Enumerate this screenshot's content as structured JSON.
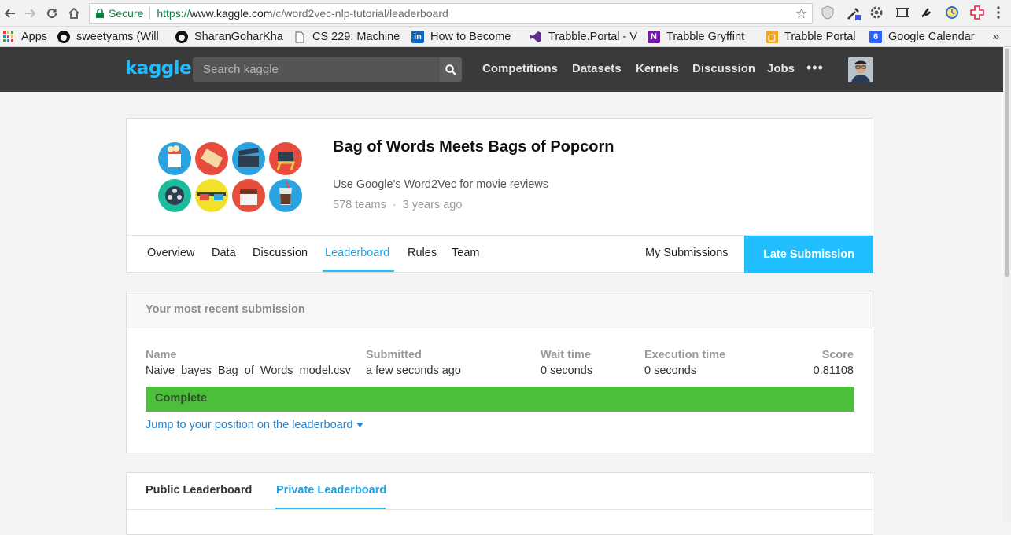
{
  "browser": {
    "secure_label": "Secure",
    "url_scheme": "https://",
    "url_host": "www.kaggle.com",
    "url_path": "/c/word2vec-nlp-tutorial/leaderboard"
  },
  "bookmarks": [
    {
      "label": "Apps",
      "icon": "apps-grid-icon"
    },
    {
      "label": "sweetyams (Will",
      "icon": "github-icon"
    },
    {
      "label": "SharanGoharKha",
      "icon": "github-icon"
    },
    {
      "label": "CS 229: Machine",
      "icon": "document-icon"
    },
    {
      "label": "How to Become",
      "icon": "linkedin-icon"
    },
    {
      "label": "Trabble.Portal - V",
      "icon": "visual-studio-icon"
    },
    {
      "label": "Trabble Gryffint",
      "icon": "onenote-icon"
    },
    {
      "label": "Trabble Portal",
      "icon": "bookmark-icon"
    },
    {
      "label": "Google Calendar",
      "icon": "calendar-icon"
    }
  ],
  "header": {
    "logo": "kaggle",
    "search_placeholder": "Search kaggle",
    "nav": [
      "Competitions",
      "Datasets",
      "Kernels",
      "Discussion",
      "Jobs"
    ],
    "more": "•••"
  },
  "competition": {
    "title": "Bag of Words Meets Bags of Popcorn",
    "subtitle": "Use Google's Word2Vec for movie reviews",
    "teams": "578 teams",
    "dot": "·",
    "age": "3 years ago",
    "tabs": [
      "Overview",
      "Data",
      "Discussion",
      "Leaderboard",
      "Rules",
      "Team"
    ],
    "active_tab": "Leaderboard",
    "my_submissions": "My Submissions",
    "late_submission": "Late Submission"
  },
  "recent_submission": {
    "heading": "Your most recent submission",
    "columns": {
      "name": "Name",
      "submitted": "Submitted",
      "wait": "Wait time",
      "execution": "Execution time",
      "score": "Score"
    },
    "values": {
      "name": "Naive_bayes_Bag_of_Words_model.csv",
      "submitted": "a few seconds ago",
      "wait": "0 seconds",
      "execution": "0 seconds",
      "score": "0.81108"
    },
    "status": "Complete",
    "jump_link": "Jump to your position on the leaderboard"
  },
  "leaderboard": {
    "public_tab": "Public Leaderboard",
    "private_tab": "Private Leaderboard"
  },
  "colors": {
    "kaggle_blue": "#20beff",
    "header_bg": "#3a3a3a",
    "complete_green": "#4cbe3c",
    "link_blue": "#2a82c9"
  }
}
